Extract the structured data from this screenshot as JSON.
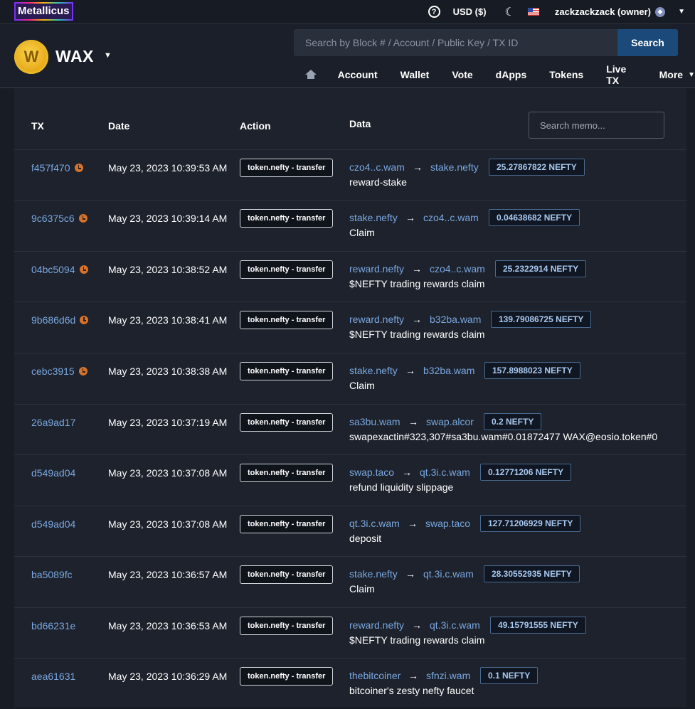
{
  "topbar": {
    "brand": "Metallicus",
    "currency": "USD ($)",
    "user": "zackzackzack (owner)"
  },
  "navbar": {
    "chain": "WAX",
    "search_placeholder": "Search by Block # / Account / Public Key / TX ID",
    "search_button": "Search",
    "menu": [
      "Account",
      "Wallet",
      "Vote",
      "dApps",
      "Tokens",
      "Live TX",
      "More"
    ]
  },
  "table": {
    "headers": {
      "tx": "TX",
      "date": "Date",
      "action": "Action",
      "data": "Data"
    },
    "memo_placeholder": "Search memo...",
    "rows": [
      {
        "tx": "f457f470",
        "pending": true,
        "date": "May 23, 2023 10:39:53 AM",
        "action": "token.nefty - transfer",
        "from": "czo4..c.wam",
        "to": "stake.nefty",
        "amount": "25.27867822 NEFTY",
        "memo": "reward-stake"
      },
      {
        "tx": "9c6375c6",
        "pending": true,
        "date": "May 23, 2023 10:39:14 AM",
        "action": "token.nefty - transfer",
        "from": "stake.nefty",
        "to": "czo4..c.wam",
        "amount": "0.04638682 NEFTY",
        "memo": "Claim"
      },
      {
        "tx": "04bc5094",
        "pending": true,
        "date": "May 23, 2023 10:38:52 AM",
        "action": "token.nefty - transfer",
        "from": "reward.nefty",
        "to": "czo4..c.wam",
        "amount": "25.2322914 NEFTY",
        "memo": "$NEFTY trading rewards claim"
      },
      {
        "tx": "9b686d6d",
        "pending": true,
        "date": "May 23, 2023 10:38:41 AM",
        "action": "token.nefty - transfer",
        "from": "reward.nefty",
        "to": "b32ba.wam",
        "amount": "139.79086725 NEFTY",
        "memo": "$NEFTY trading rewards claim"
      },
      {
        "tx": "cebc3915",
        "pending": true,
        "date": "May 23, 2023 10:38:38 AM",
        "action": "token.nefty - transfer",
        "from": "stake.nefty",
        "to": "b32ba.wam",
        "amount": "157.8988023 NEFTY",
        "memo": "Claim"
      },
      {
        "tx": "26a9ad17",
        "pending": false,
        "date": "May 23, 2023 10:37:19 AM",
        "action": "token.nefty - transfer",
        "from": "sa3bu.wam",
        "to": "swap.alcor",
        "amount": "0.2 NEFTY",
        "memo": "swapexactin#323,307#sa3bu.wam#0.01872477 WAX@eosio.token#0"
      },
      {
        "tx": "d549ad04",
        "pending": false,
        "date": "May 23, 2023 10:37:08 AM",
        "action": "token.nefty - transfer",
        "from": "swap.taco",
        "to": "qt.3i.c.wam",
        "amount": "0.12771206 NEFTY",
        "memo": "refund liquidity slippage"
      },
      {
        "tx": "d549ad04",
        "pending": false,
        "date": "May 23, 2023 10:37:08 AM",
        "action": "token.nefty - transfer",
        "from": "qt.3i.c.wam",
        "to": "swap.taco",
        "amount": "127.71206929 NEFTY",
        "memo": "deposit"
      },
      {
        "tx": "ba5089fc",
        "pending": false,
        "date": "May 23, 2023 10:36:57 AM",
        "action": "token.nefty - transfer",
        "from": "stake.nefty",
        "to": "qt.3i.c.wam",
        "amount": "28.30552935 NEFTY",
        "memo": "Claim"
      },
      {
        "tx": "bd66231e",
        "pending": false,
        "date": "May 23, 2023 10:36:53 AM",
        "action": "token.nefty - transfer",
        "from": "reward.nefty",
        "to": "qt.3i.c.wam",
        "amount": "49.15791555 NEFTY",
        "memo": "$NEFTY trading rewards claim"
      },
      {
        "tx": "aea61631",
        "pending": false,
        "date": "May 23, 2023 10:36:29 AM",
        "action": "token.nefty - transfer",
        "from": "thebitcoiner",
        "to": "sfnzi.wam",
        "amount": "0.1 NEFTY",
        "memo": "bitcoiner's zesty nefty faucet"
      }
    ]
  }
}
